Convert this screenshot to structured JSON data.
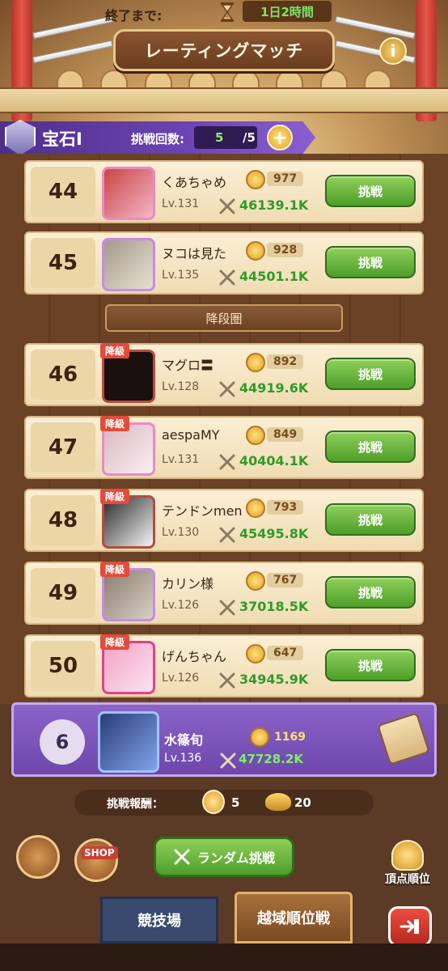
{
  "header": {
    "title": "レーティングマッチ",
    "info_icon": "i",
    "timer_label": "終了まで:",
    "timer_value": "1日2時間"
  },
  "tier": {
    "name": "宝石Ⅰ",
    "tries_label": "挑戦回数:",
    "tries_current": "5",
    "tries_max": "/5",
    "add_symbol": "+"
  },
  "zone_divider": "降段圏",
  "demote_tag": "降級",
  "challenge_label": "挑戦",
  "players": [
    {
      "rank": "44",
      "name": "くあちゃめ",
      "level": "Lv.131",
      "score": "977",
      "power": "46139.1K",
      "demote": false
    },
    {
      "rank": "45",
      "name": "ヌコは見た",
      "level": "Lv.135",
      "score": "928",
      "power": "44501.1K",
      "demote": false
    },
    {
      "rank": "46",
      "name": "マグロ〓",
      "level": "Lv.128",
      "score": "892",
      "power": "44919.6K",
      "demote": true
    },
    {
      "rank": "47",
      "name": "aespaMY",
      "level": "Lv.131",
      "score": "849",
      "power": "40404.1K",
      "demote": true
    },
    {
      "rank": "48",
      "name": "テンドンmen",
      "level": "Lv.130",
      "score": "793",
      "power": "45495.8K",
      "demote": true
    },
    {
      "rank": "49",
      "name": "カリン様",
      "level": "Lv.126",
      "score": "767",
      "power": "37018.5K",
      "demote": true
    },
    {
      "rank": "50",
      "name": "げんちゃん",
      "level": "Lv.126",
      "score": "647",
      "power": "34945.9K",
      "demote": true
    }
  ],
  "me": {
    "rank": "6",
    "name": "水篠旬",
    "level": "Lv.136",
    "score": "1169",
    "power": "47728.2K"
  },
  "reward": {
    "label": "挑戦報酬：",
    "medal_count": "5",
    "lamp_count": "20"
  },
  "bottom": {
    "shop_label": "SHOP",
    "random_label": "ランダム挑戦",
    "peak_label": "頂点順位",
    "tab_arena": "競技場",
    "tab_rank": "越域順位戦"
  },
  "colors": {
    "accent_green": "#4e9e2a",
    "tier_purple": "#6d44b3",
    "power_green": "#2e9b2a",
    "demote_red": "#e44b3a"
  }
}
